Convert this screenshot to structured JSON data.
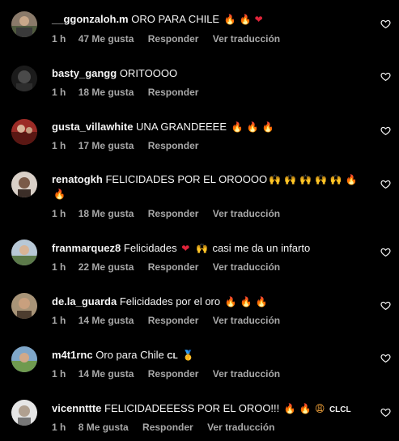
{
  "colors": {
    "background": "#000000",
    "text": "#f5f5f5",
    "meta": "#a8a8a8",
    "fire": "#ff7a1a",
    "heart": "#e0243a"
  },
  "comments": [
    {
      "username": "__ggonzaloh.m",
      "text": "ORO PARA CHILE",
      "time": "1 h",
      "likes": "47 Me gusta",
      "reply": "Responder",
      "translate": "Ver traducción"
    },
    {
      "username": "basty_gangg",
      "text": "ORITOOOO",
      "time": "1 h",
      "likes": "18 Me gusta",
      "reply": "Responder"
    },
    {
      "username": "gusta_villawhite",
      "text": "UNA GRANDEEEE",
      "time": "1 h",
      "likes": "17 Me gusta",
      "reply": "Responder"
    },
    {
      "username": "renatogkh",
      "text": "FELICIDADES POR EL OROOOO",
      "time": "1 h",
      "likes": "18 Me gusta",
      "reply": "Responder",
      "translate": "Ver traducción"
    },
    {
      "username": "franmarquez8",
      "text": "Felicidades",
      "text2": "casi me da un infarto",
      "time": "1 h",
      "likes": "22 Me gusta",
      "reply": "Responder",
      "translate": "Ver traducción"
    },
    {
      "username": "de.la_guarda",
      "text": "Felicidades por el oro",
      "time": "1 h",
      "likes": "14 Me gusta",
      "reply": "Responder",
      "translate": "Ver traducción"
    },
    {
      "username": "m4t1rnc",
      "text": "Oro para Chile",
      "flag": "CL",
      "time": "1 h",
      "likes": "14 Me gusta",
      "reply": "Responder",
      "translate": "Ver traducción"
    },
    {
      "username": "vicennttte",
      "text": "FELICIDADEEESS POR EL OROO!!!",
      "flags": "CLCL",
      "time": "1 h",
      "likes": "8 Me gusta",
      "reply": "Responder",
      "translate": "Ver traducción"
    }
  ]
}
